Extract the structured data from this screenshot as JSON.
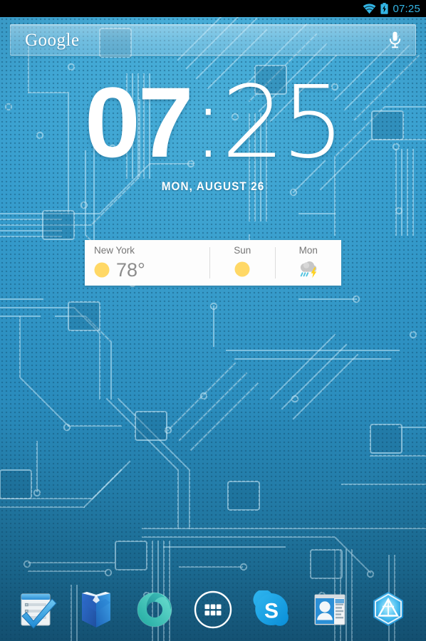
{
  "statusbar": {
    "wifi_icon": "wifi-icon",
    "battery_icon": "battery-charging-icon",
    "time": "07:25",
    "accent_color": "#33b5e5"
  },
  "search": {
    "logo_text": "Google",
    "logo_icon": "google-logo",
    "mic_icon": "microphone-icon",
    "placeholder": ""
  },
  "clock_widget": {
    "hour": "07",
    "minute": ":25",
    "date": "MON, AUGUST 26"
  },
  "weather_widget": {
    "city": "New York",
    "current_temp": "78°",
    "current_icon": "sunny-icon",
    "forecast": [
      {
        "day": "Sun",
        "icon": "sunny-icon"
      },
      {
        "day": "Mon",
        "icon": "thunderstorm-icon"
      }
    ],
    "sun_color": "#ffd866",
    "text_color": "#767676"
  },
  "dock": {
    "items": [
      {
        "name": "tasks-app-icon",
        "label": "Tasks"
      },
      {
        "name": "play-books-app-icon",
        "label": "Play Books"
      },
      {
        "name": "ring-app-icon",
        "label": "Ring"
      },
      {
        "name": "app-drawer-button",
        "label": "Apps"
      },
      {
        "name": "skype-app-icon",
        "label": "Skype"
      },
      {
        "name": "contacts-app-icon",
        "label": "Contacts"
      },
      {
        "name": "ingress-app-icon",
        "label": "Ingress"
      }
    ]
  },
  "wallpaper": {
    "name": "circuit-board-wallpaper",
    "base_color": "#2b93c6",
    "trace_color": "#8fc9e2"
  }
}
